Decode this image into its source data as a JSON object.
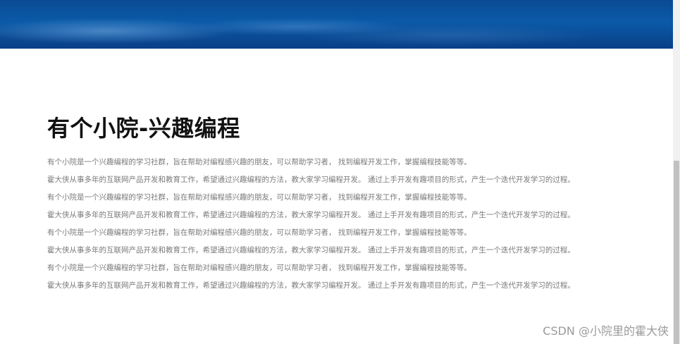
{
  "header": {
    "banner": "blue-sky-banner"
  },
  "main": {
    "title": "有个小院-兴趣编程",
    "paragraphs": [
      "有个小院是一个兴趣编程的学习社群，旨在帮助对编程感兴趣的朋友，可以帮助学习者， 找到编程开发工作，掌握编程技能等等。",
      "霍大侠从事多年的互联网产品开发和教育工作，希望通过兴趣编程的方法，教大家学习编程开发。 通过上手开发有趣项目的形式，产生一个迭代开发学习的过程。",
      "有个小院是一个兴趣编程的学习社群，旨在帮助对编程感兴趣的朋友，可以帮助学习者， 找到编程开发工作，掌握编程技能等等。",
      "霍大侠从事多年的互联网产品开发和教育工作，希望通过兴趣编程的方法，教大家学习编程开发。 通过上手开发有趣项目的形式，产生一个迭代开发学习的过程。",
      "有个小院是一个兴趣编程的学习社群，旨在帮助对编程感兴趣的朋友，可以帮助学习者， 找到编程开发工作，掌握编程技能等等。",
      "霍大侠从事多年的互联网产品开发和教育工作，希望通过兴趣编程的方法，教大家学习编程开发。 通过上手开发有趣项目的形式，产生一个迭代开发学习的过程。",
      "有个小院是一个兴趣编程的学习社群，旨在帮助对编程感兴趣的朋友，可以帮助学习者， 找到编程开发工作，掌握编程技能等等。",
      "霍大侠从事多年的互联网产品开发和教育工作，希望通过兴趣编程的方法，教大家学习编程开发。 通过上手开发有趣项目的形式，产生一个迭代开发学习的过程。"
    ]
  },
  "watermark": "CSDN @小院里的霍大侠",
  "colors": {
    "banner_blue": "#0b5aa8",
    "title": "#111111",
    "body_text": "#7a7a7a",
    "scroll_thumb": "#c1c1c1"
  }
}
